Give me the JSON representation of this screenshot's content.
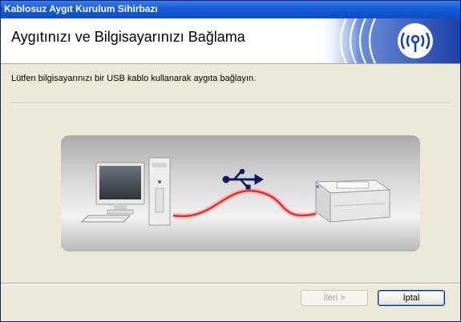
{
  "window": {
    "title": "Kablosuz Aygıt Kurulum Sihirbazı"
  },
  "header": {
    "title": "Aygıtınızı ve Bilgisayarınızı Bağlama"
  },
  "main": {
    "instruction": "Lütfen bilgisayarınızı bir USB kablo kullanarak aygıta bağlayın."
  },
  "buttons": {
    "next": "İleri >",
    "cancel": "İptal"
  },
  "icons": {
    "logo": "wireless-signal-icon",
    "usb": "usb-icon",
    "computer": "computer-icon",
    "printer": "printer-icon"
  }
}
